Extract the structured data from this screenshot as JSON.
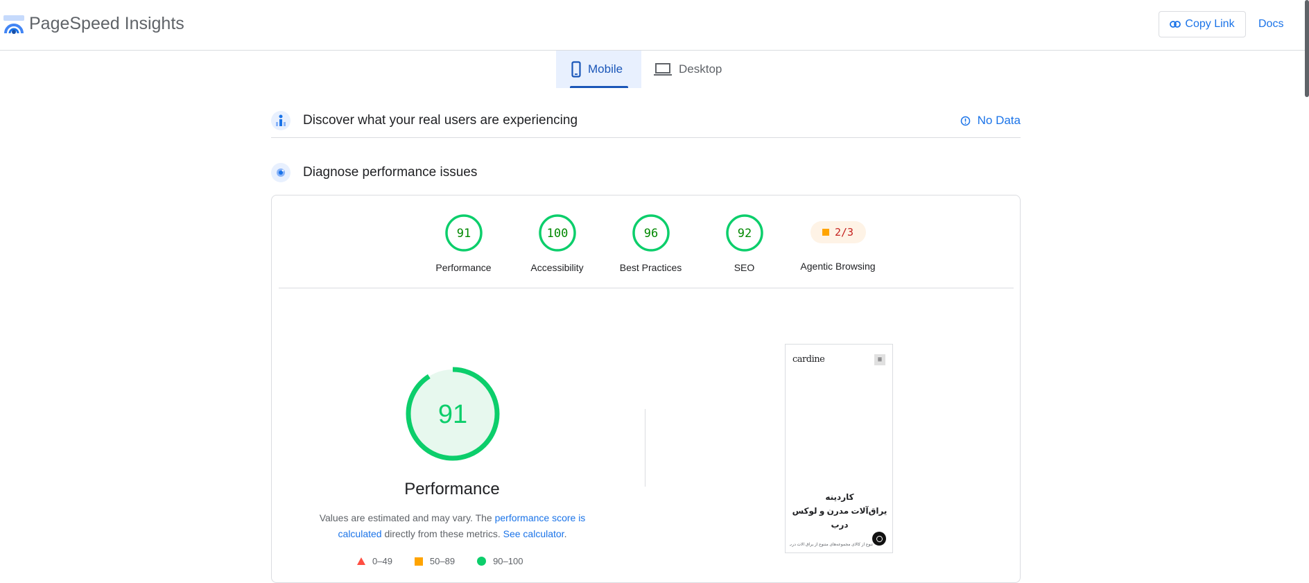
{
  "header": {
    "title": "PageSpeed Insights",
    "copy_link_label": "Copy Link",
    "docs_label": "Docs"
  },
  "tabs": [
    {
      "label": "Mobile",
      "icon": "smartphone-icon",
      "selected": true
    },
    {
      "label": "Desktop",
      "icon": "laptop-icon",
      "selected": false
    }
  ],
  "field_data": {
    "title": "Discover what your real users are experiencing",
    "status_label": "No Data"
  },
  "diagnose": {
    "title": "Diagnose performance issues"
  },
  "categories": [
    {
      "score": "91",
      "label": "Performance"
    },
    {
      "score": "100",
      "label": "Accessibility"
    },
    {
      "score": "96",
      "label": "Best Practices"
    },
    {
      "score": "92",
      "label": "SEO"
    },
    {
      "score": "2/3",
      "label": "Agentic Browsing"
    }
  ],
  "performance": {
    "score": "91",
    "label": "Performance",
    "note_prefix": "Values are estimated and may vary. The ",
    "note_link": "performance score is calculated",
    "note_middle": " directly from these metrics. ",
    "note_link2": "See calculator",
    "note_suffix": "."
  },
  "legend": [
    {
      "range": "0–49",
      "shape": "triangle",
      "color": "#ff4e42"
    },
    {
      "range": "50–89",
      "shape": "square",
      "color": "#ffa400"
    },
    {
      "range": "90–100",
      "shape": "circle",
      "color": "#0cce6b"
    }
  ],
  "preview": {
    "brand": "cardine",
    "hero_line1": "کاردینه",
    "hero_line2": "یراق‌آلات مدرن و لوکس",
    "hero_line3": "درب",
    "hero_sub": "تنوع از کالای مجموعه‌های متنوع از یراق آلات درب، راهکار"
  },
  "colors": {
    "pass": "#0cce6b",
    "pass_text": "#008800",
    "pass_fill": "#e7f8ee",
    "average": "#ffa400",
    "fail": "#ff4e42",
    "accent": "#1a73e8"
  }
}
